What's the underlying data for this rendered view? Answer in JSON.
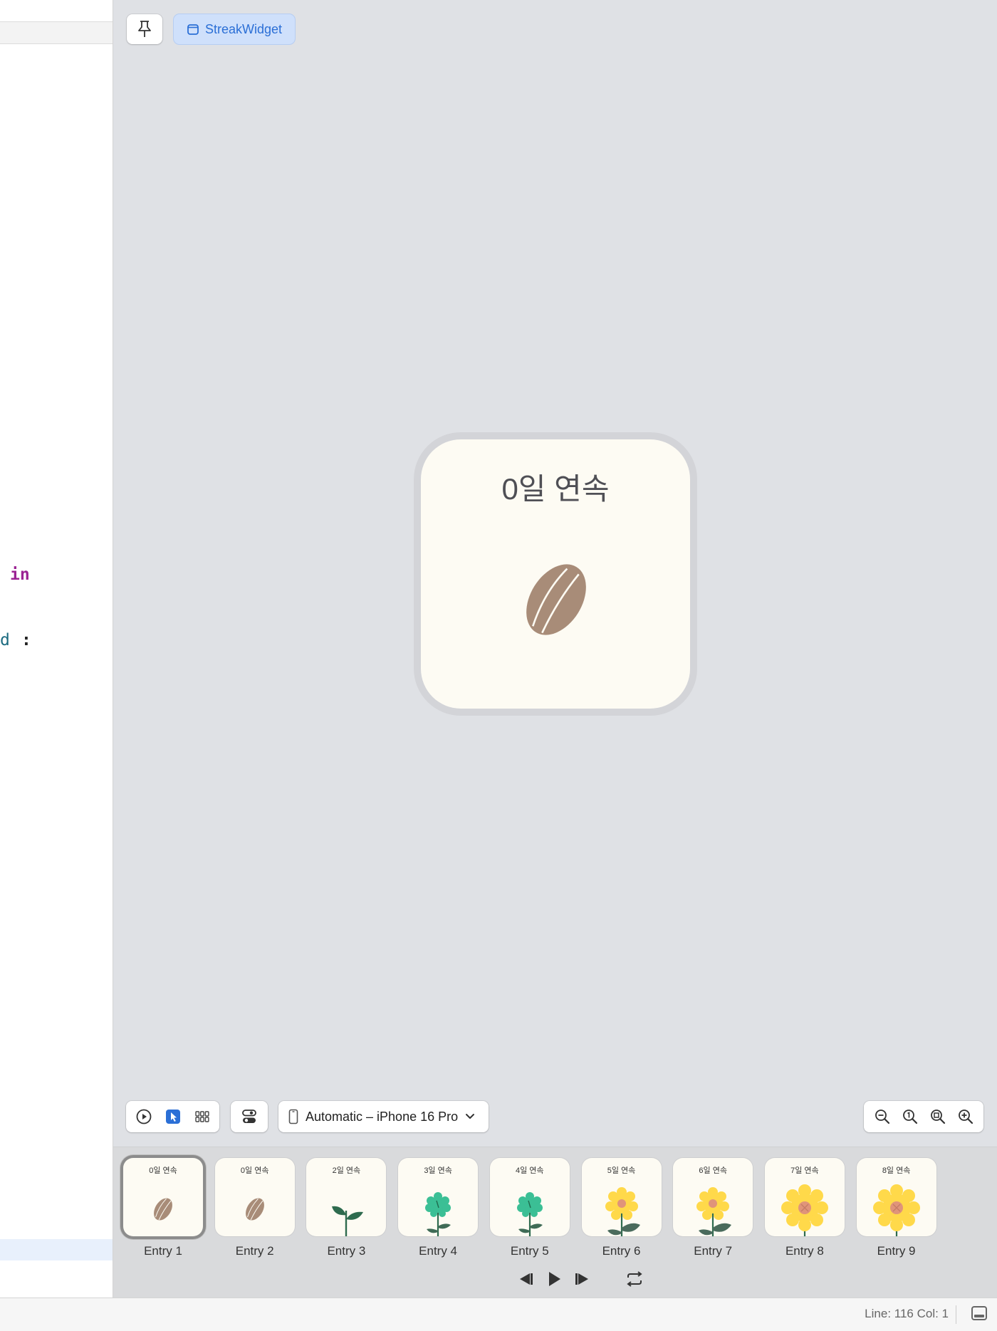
{
  "editor": {
    "code_keyword_in": "in",
    "code_identifier_d": "d",
    "code_colon": ":"
  },
  "preview": {
    "widget_chip_label": "StreakWidget",
    "widget_title": "0일 연속",
    "device_selector": "Automatic – iPhone 16 Pro"
  },
  "entries": [
    {
      "label": "Entry 1",
      "title": "0일 연속",
      "stage": "seed",
      "selected": true
    },
    {
      "label": "Entry 2",
      "title": "0일 연속",
      "stage": "seed"
    },
    {
      "label": "Entry 3",
      "title": "2일 연속",
      "stage": "sprout"
    },
    {
      "label": "Entry 4",
      "title": "3일 연속",
      "stage": "bud"
    },
    {
      "label": "Entry 5",
      "title": "4일 연속",
      "stage": "bud"
    },
    {
      "label": "Entry 6",
      "title": "5일 연속",
      "stage": "small-flower"
    },
    {
      "label": "Entry 7",
      "title": "6일 연속",
      "stage": "small-flower"
    },
    {
      "label": "Entry 8",
      "title": "7일 연속",
      "stage": "sunflower"
    },
    {
      "label": "Entry 9",
      "title": "8일 연속",
      "stage": "sunflower"
    }
  ],
  "status_bar": {
    "position": "Line: 116  Col: 1"
  },
  "colors": {
    "accent": "#2b6fd6",
    "widget_bg": "#fdfbf3",
    "seed": "#a88c78",
    "leaf": "#2e6b4e",
    "bud": "#3bbf95",
    "petal": "#ffd94a",
    "flower_center": "#e0947a"
  }
}
